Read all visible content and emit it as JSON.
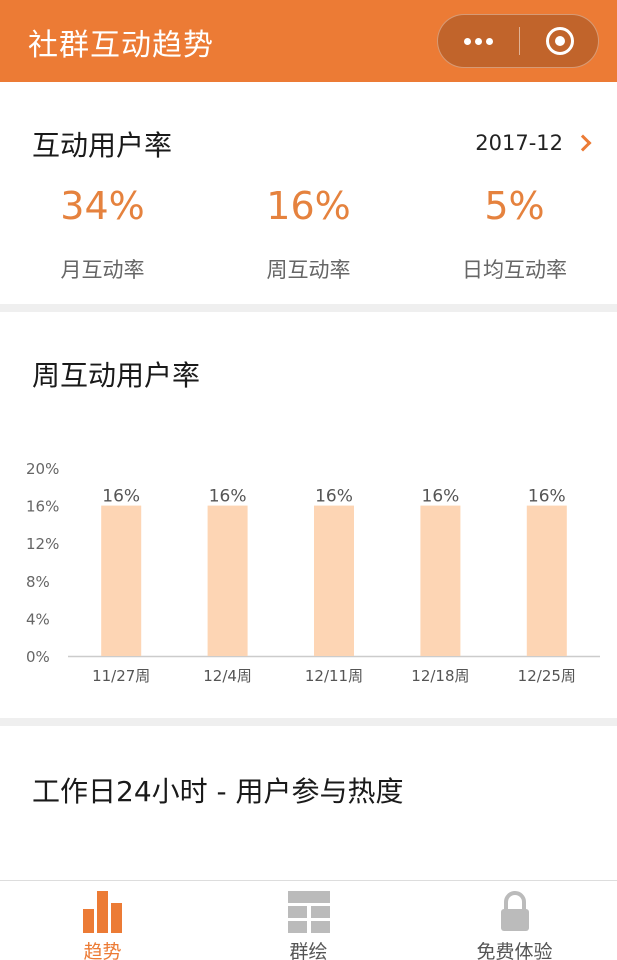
{
  "app": {
    "title": "社群互动趋势"
  },
  "capsule": {
    "more_icon": "more-dots-icon",
    "close_icon": "target-close-icon"
  },
  "summary": {
    "title": "互动用户率",
    "month": "2017-12",
    "stats": [
      {
        "value": "34%",
        "label": "月互动率"
      },
      {
        "value": "16%",
        "label": "周互动率"
      },
      {
        "value": "5%",
        "label": "日均互动率"
      }
    ]
  },
  "weekly": {
    "title": "周互动用户率"
  },
  "chart_data": {
    "type": "bar",
    "categories": [
      "11/27周",
      "12/4周",
      "12/11周",
      "12/18周",
      "12/25周"
    ],
    "values": [
      16,
      16,
      16,
      16,
      16
    ],
    "value_labels": [
      "16%",
      "16%",
      "16%",
      "16%",
      "16%"
    ],
    "yticks": [
      "0%",
      "4%",
      "8%",
      "12%",
      "16%",
      "20%"
    ],
    "ylim": [
      0,
      20
    ],
    "bar_color": "#fdd5b4"
  },
  "heat": {
    "title": "工作日24小时 - 用户参与热度"
  },
  "tabs": [
    {
      "label": "趋势",
      "icon": "bar-chart-icon",
      "active": true
    },
    {
      "label": "群绘",
      "icon": "grid-icon",
      "active": false
    },
    {
      "label": "免费体验",
      "icon": "lock-icon",
      "active": false
    }
  ],
  "colors": {
    "accent": "#ec7b35",
    "stat": "#e5823e"
  }
}
